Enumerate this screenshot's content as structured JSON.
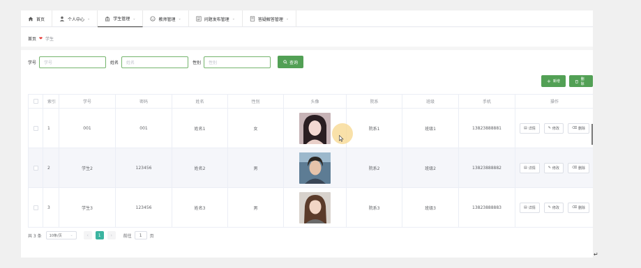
{
  "nav": {
    "items": [
      {
        "label": "首页",
        "icon": "home-icon",
        "chevron": false
      },
      {
        "label": "个人中心",
        "icon": "user-icon",
        "chevron": true
      },
      {
        "label": "学生管理",
        "icon": "bank-icon",
        "chevron": true
      },
      {
        "label": "教师管理",
        "icon": "face-icon",
        "chevron": true
      },
      {
        "label": "问题发布管理",
        "icon": "list-icon",
        "chevron": true
      },
      {
        "label": "答疑解答管理",
        "icon": "book-icon",
        "chevron": true
      }
    ]
  },
  "breadcrumb": {
    "home": "首页",
    "current": "学生"
  },
  "search": {
    "student_no_label": "学号",
    "student_no_placeholder": "学号",
    "name_label": "姓名",
    "name_placeholder": "姓名",
    "gender_label": "性别",
    "gender_placeholder": "性别",
    "query_label": "查询"
  },
  "actions": {
    "add_label": "新增",
    "delete_label": "删除"
  },
  "table": {
    "headers": [
      "索引",
      "学号",
      "密码",
      "姓名",
      "性别",
      "头像",
      "院系",
      "班级",
      "手机",
      "操作"
    ],
    "rows": [
      {
        "index": "1",
        "student_no": "001",
        "password": "001",
        "name": "姓名1",
        "gender": "女",
        "dept": "院系1",
        "class": "班级1",
        "phone": "13823888881",
        "avatar": "portrait-woman-1"
      },
      {
        "index": "2",
        "student_no": "学生2",
        "password": "123456",
        "name": "姓名2",
        "gender": "男",
        "dept": "院系2",
        "class": "班级2",
        "phone": "13823888882",
        "avatar": "portrait-man"
      },
      {
        "index": "3",
        "student_no": "学生3",
        "password": "123456",
        "name": "姓名3",
        "gender": "男",
        "dept": "院系3",
        "class": "班级3",
        "phone": "13823888883",
        "avatar": "portrait-woman-2"
      }
    ],
    "op_detail": "详情",
    "op_edit": "修改",
    "op_delete": "删除"
  },
  "pagination": {
    "total": "共 3 条",
    "page_size": "10条/页",
    "current_page": "1",
    "goto_label": "前往",
    "goto_value": "1",
    "page_unit": "页"
  },
  "colors": {
    "primary": "#52a055",
    "page_active": "#3bb4a0",
    "heart": "#e53935"
  }
}
